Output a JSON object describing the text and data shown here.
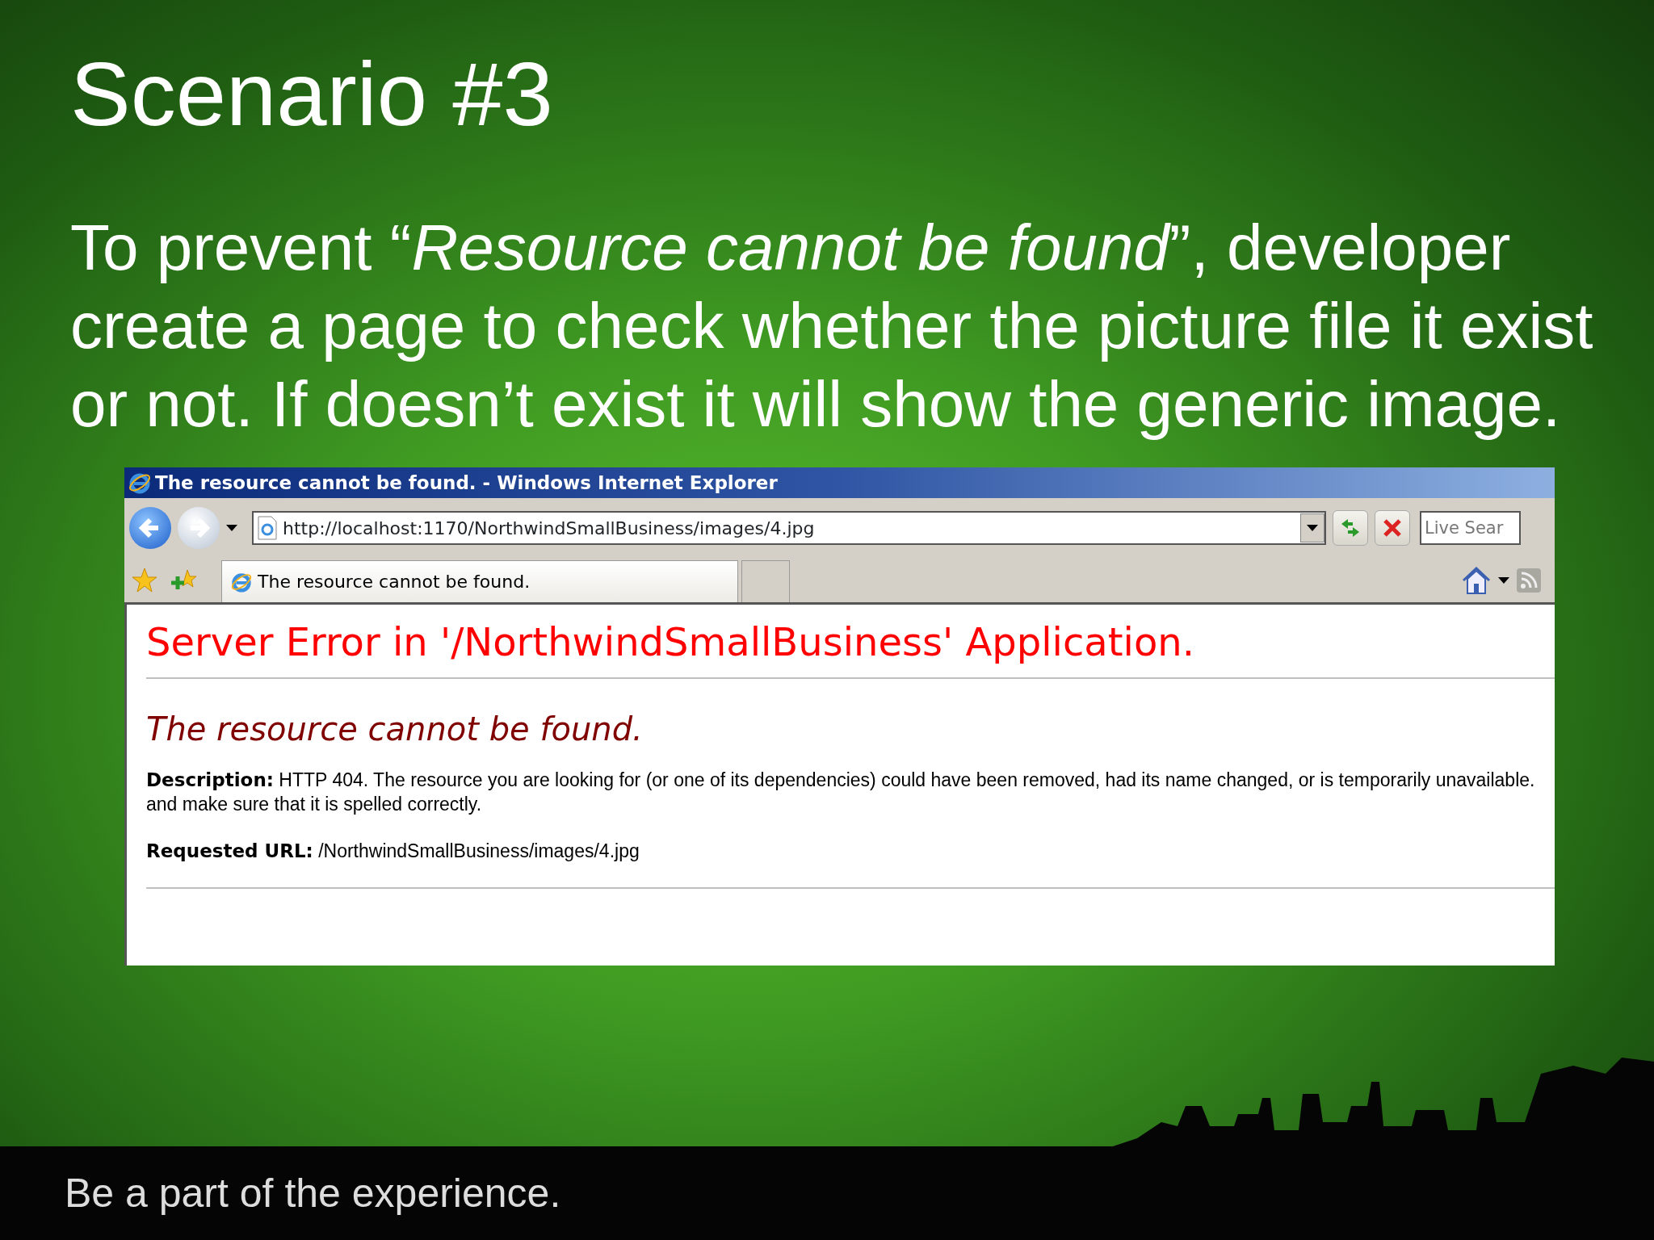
{
  "slide": {
    "title": "Scenario #3",
    "body": "To prevent “*Resource cannot be found*”, developer create a page to check whether the picture file it exist or not. If doesn’t exist it will show the generic image.",
    "footer": "Be a part of the experience."
  },
  "browser": {
    "window_title": "The resource cannot be found. - Windows Internet Explorer",
    "address": "http://localhost:1170/NorthwindSmallBusiness/images/4.jpg",
    "search_placeholder": "Live Sear",
    "tabs": [
      {
        "label": "The resource cannot be found.",
        "selected": true
      }
    ],
    "page": {
      "heading": "Server Error in '/NorthwindSmallBusiness' Application.",
      "subheading": "The resource cannot be found.",
      "fields": [
        {
          "label": "Description:",
          "lines": [
            "HTTP 404. The resource you are looking for (or one of its dependencies) could have been removed, had its name changed, or is temporarily unavailable.",
            "and make sure that it is spelled correctly."
          ]
        },
        {
          "label": "Requested URL:",
          "lines": [
            "/NorthwindSmallBusiness/images/4.jpg"
          ]
        }
      ]
    }
  }
}
